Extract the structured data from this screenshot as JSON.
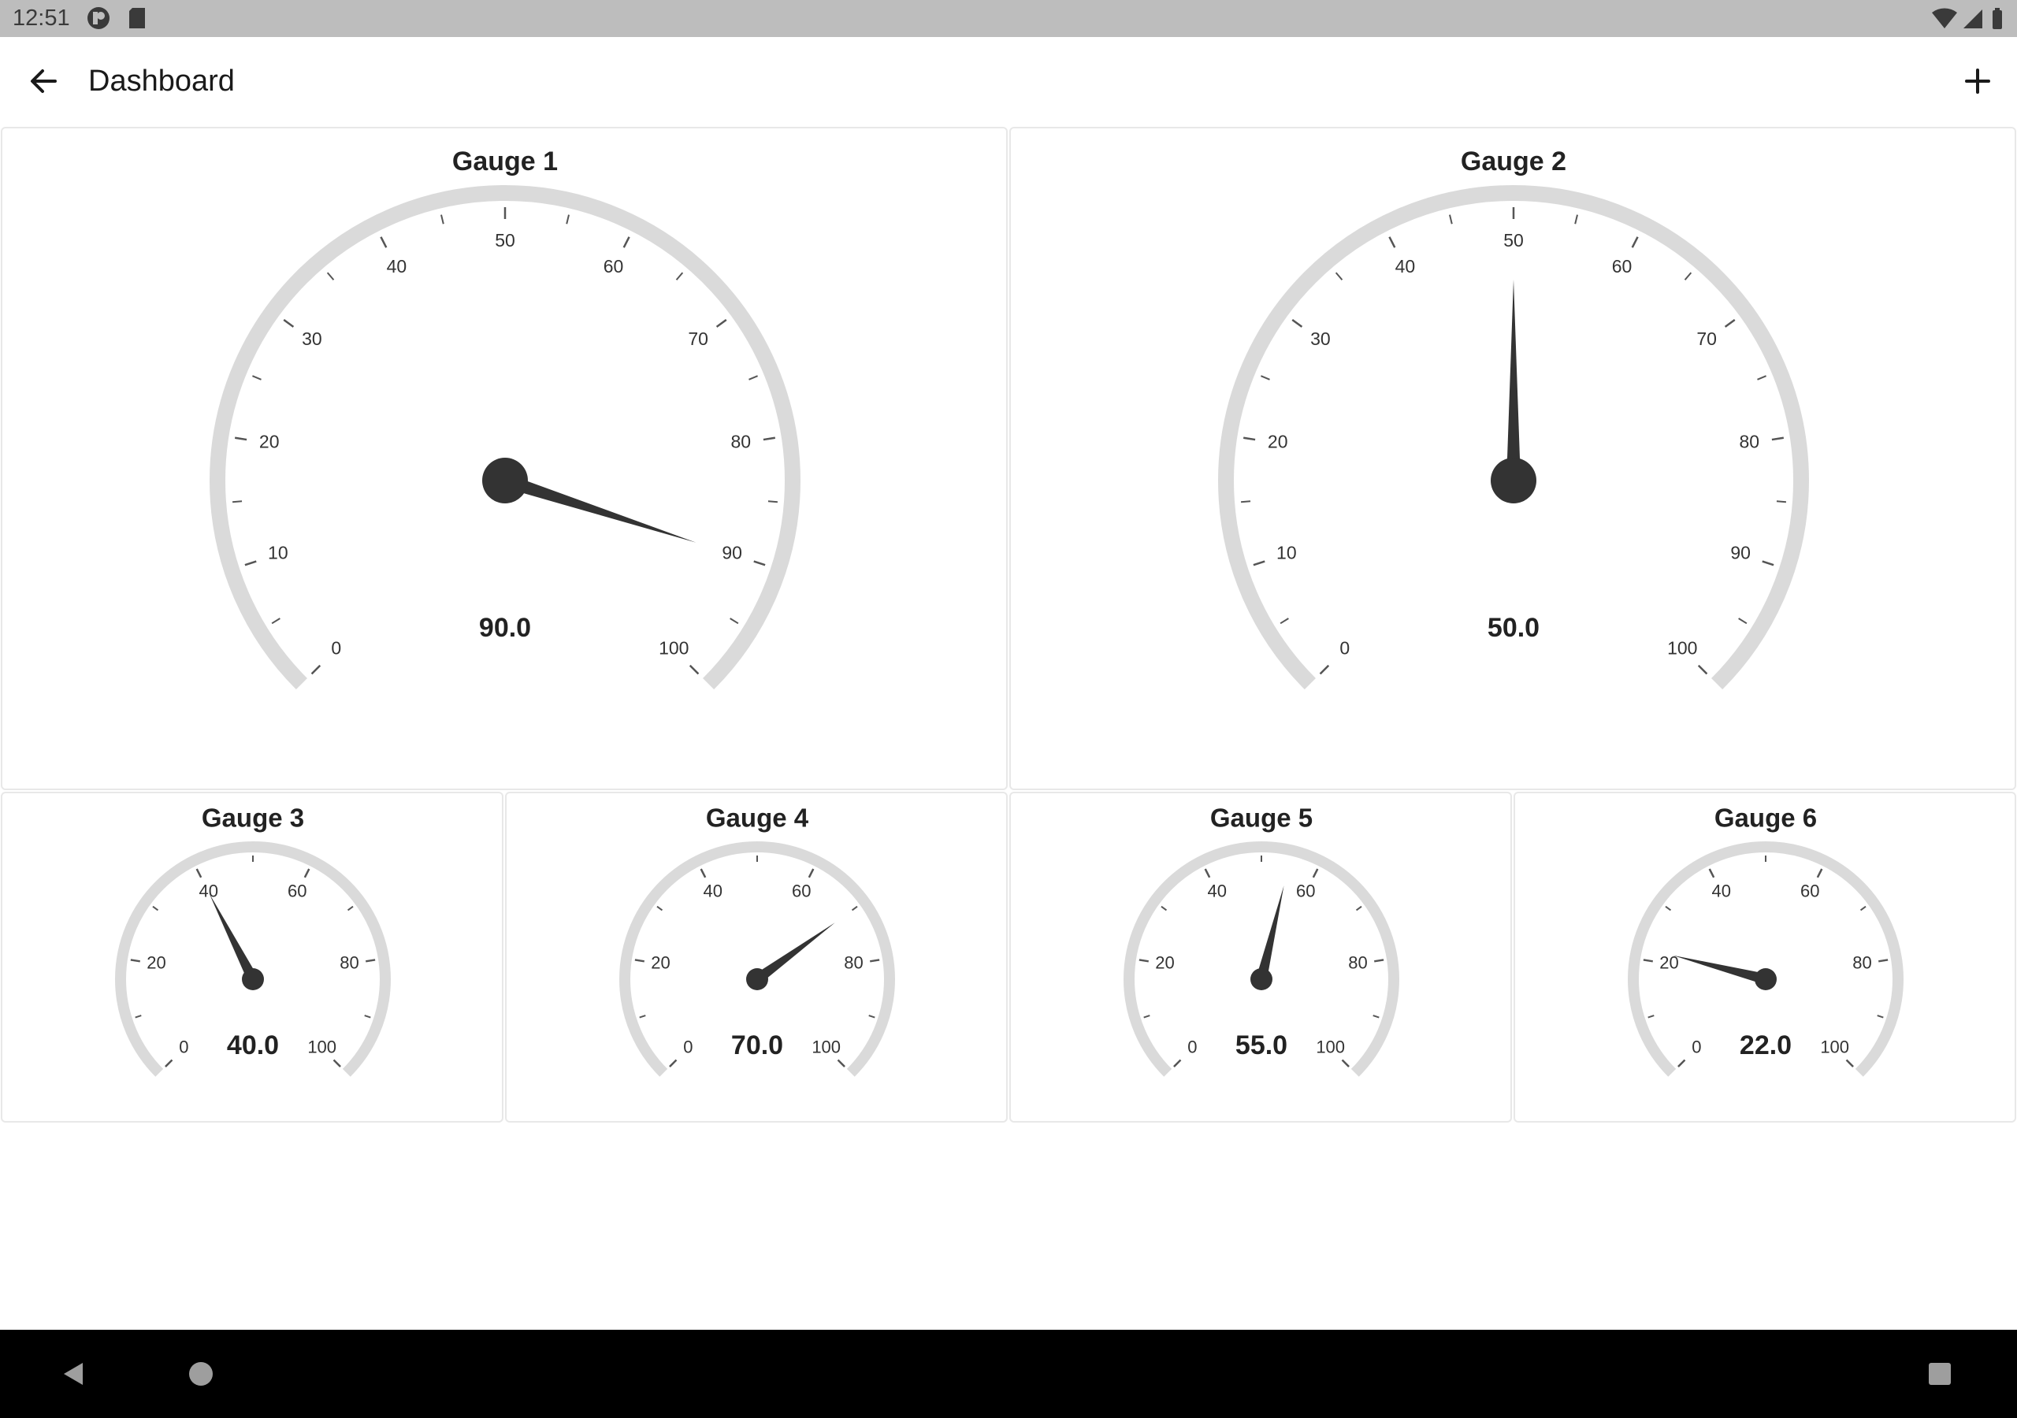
{
  "status_bar": {
    "time": "12:51",
    "left_icons": [
      "app-notification-icon",
      "sd-card-icon"
    ],
    "right_icons": [
      "wifi-icon",
      "cell-signal-icon",
      "battery-icon"
    ]
  },
  "app_bar": {
    "title": "Dashboard",
    "back_icon": "arrow-back-icon",
    "add_icon": "plus-icon"
  },
  "colors": {
    "track": "#dadada",
    "needle": "#333333",
    "tick": "#555555",
    "panel_border": "#e8e8e8",
    "status_bar": "#bdbdbd",
    "nav_bar": "#000000"
  },
  "gauges": [
    {
      "title": "Gauge 1",
      "value": 90,
      "value_text": "90.0",
      "min": 0,
      "max": 100,
      "major_labels": [
        "0",
        "10",
        "20",
        "30",
        "40",
        "50",
        "60",
        "70",
        "80",
        "90",
        "100"
      ]
    },
    {
      "title": "Gauge 2",
      "value": 50,
      "value_text": "50.0",
      "min": 0,
      "max": 100,
      "major_labels": [
        "0",
        "10",
        "20",
        "30",
        "40",
        "50",
        "60",
        "70",
        "80",
        "90",
        "100"
      ]
    },
    {
      "title": "Gauge 3",
      "value": 40,
      "value_text": "40.0",
      "min": 0,
      "max": 100,
      "major_labels": [
        "0",
        "20",
        "40",
        "60",
        "80",
        "100"
      ]
    },
    {
      "title": "Gauge 4",
      "value": 70,
      "value_text": "70.0",
      "min": 0,
      "max": 100,
      "major_labels": [
        "0",
        "20",
        "40",
        "60",
        "80",
        "100"
      ]
    },
    {
      "title": "Gauge 5",
      "value": 55,
      "value_text": "55.0",
      "min": 0,
      "max": 100,
      "major_labels": [
        "0",
        "20",
        "40",
        "60",
        "80",
        "100"
      ]
    },
    {
      "title": "Gauge 6",
      "value": 22,
      "value_text": "22.0",
      "min": 0,
      "max": 100,
      "major_labels": [
        "0",
        "20",
        "40",
        "60",
        "80",
        "100"
      ]
    }
  ],
  "nav_bar": {
    "icons": [
      "nav-back-icon",
      "nav-home-icon",
      "nav-recents-icon"
    ]
  }
}
